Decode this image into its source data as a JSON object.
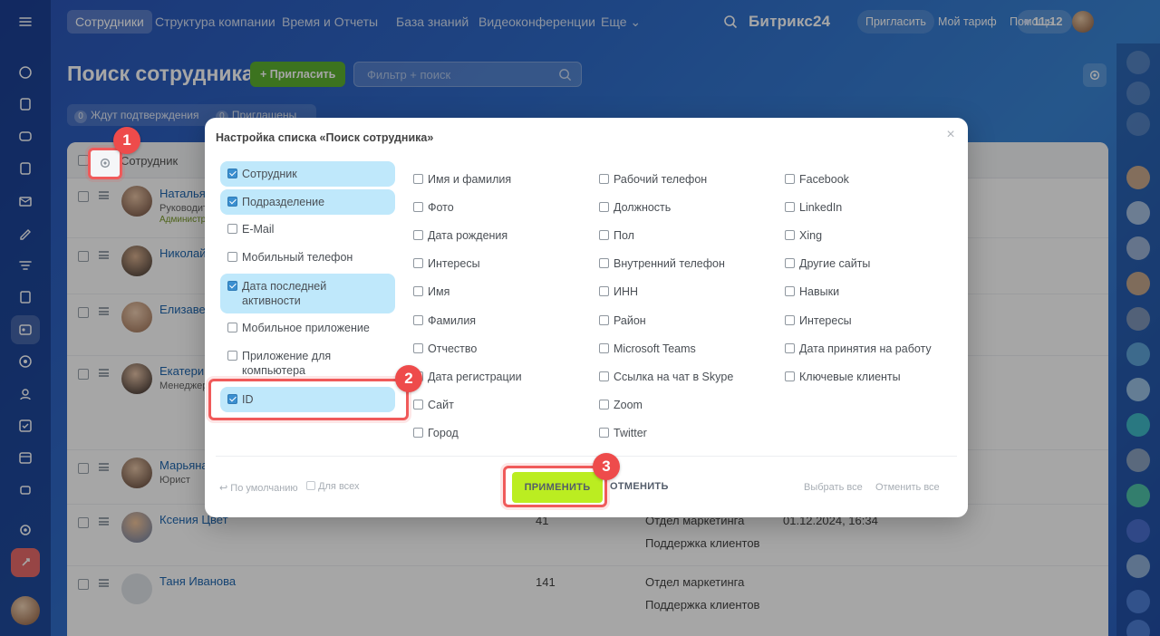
{
  "topbar": {
    "nav": [
      {
        "label": "Сотрудники",
        "active": true
      },
      {
        "label": "Структура компании"
      },
      {
        "label": "Время и Отчеты"
      },
      {
        "label": "База знаний"
      },
      {
        "label": "Видеоконференции"
      },
      {
        "label": "Еще"
      }
    ],
    "brand": "Битрикс24",
    "invite": "Пригласить",
    "tariff": "Мой тариф",
    "help": "Помощь",
    "time": "11:12"
  },
  "page": {
    "title": "Поиск сотрудника",
    "invite_button": "Пригласить",
    "filter_placeholder": "Фильтр + поиск",
    "tabs": [
      {
        "count": "0",
        "label": "Ждут подтверждения"
      },
      {
        "count": "0",
        "label": "Приглашены"
      }
    ]
  },
  "grid": {
    "header_employee": "Сотрудник",
    "rows": [
      {
        "name": "Наталья М",
        "sub": "Руководит",
        "sub2": "Администра"
      },
      {
        "name": "Николай"
      },
      {
        "name": "Елизавета"
      },
      {
        "name": "Екатерин",
        "sub": "Менеджер"
      },
      {
        "name": "Марьяна",
        "sub": "Юрист"
      },
      {
        "name": "Ксения Цвет",
        "id": "41",
        "dept1": "Отдел маркетинга",
        "dept2": "Поддержка клиентов",
        "date": "01.12.2024, 16:34"
      },
      {
        "name": "Таня Иванова",
        "id": "141",
        "dept1": "Отдел маркетинга",
        "dept2": "Поддержка клиентов"
      }
    ]
  },
  "dialog": {
    "title": "Настройка списка «Поиск сотрудника»",
    "columns": [
      [
        {
          "label": "Сотрудник",
          "checked": true
        },
        {
          "label": "Подразделение",
          "checked": true
        },
        {
          "label": "E-Mail",
          "checked": false
        },
        {
          "label": "Мобильный телефон",
          "checked": false
        },
        {
          "label": "Дата последней активности",
          "checked": true
        },
        {
          "label": "Мобильное приложение",
          "checked": false
        },
        {
          "label": "Приложение для компьютера",
          "checked": false
        },
        {
          "label": "ID",
          "checked": true
        }
      ],
      [
        {
          "label": "Имя и фамилия",
          "checked": false
        },
        {
          "label": "Фото",
          "checked": false
        },
        {
          "label": "Дата рождения",
          "checked": false
        },
        {
          "label": "Интересы",
          "checked": false
        },
        {
          "label": "Имя",
          "checked": false
        },
        {
          "label": "Фамилия",
          "checked": false
        },
        {
          "label": "Отчество",
          "checked": false
        },
        {
          "label": "Дата регистрации",
          "checked": false
        },
        {
          "label": "Сайт",
          "checked": false
        },
        {
          "label": "Город",
          "checked": false
        }
      ],
      [
        {
          "label": "Рабочий телефон",
          "checked": false
        },
        {
          "label": "Должность",
          "checked": false
        },
        {
          "label": "Пол",
          "checked": false
        },
        {
          "label": "Внутренний телефон",
          "checked": false
        },
        {
          "label": "ИНН",
          "checked": false
        },
        {
          "label": "Район",
          "checked": false
        },
        {
          "label": "Microsoft Teams",
          "checked": false
        },
        {
          "label": "Ссылка на чат в Skype",
          "checked": false
        },
        {
          "label": "Zoom",
          "checked": false
        },
        {
          "label": "Twitter",
          "checked": false
        }
      ],
      [
        {
          "label": "Facebook",
          "checked": false
        },
        {
          "label": "LinkedIn",
          "checked": false
        },
        {
          "label": "Xing",
          "checked": false
        },
        {
          "label": "Другие сайты",
          "checked": false
        },
        {
          "label": "Навыки",
          "checked": false
        },
        {
          "label": "Интересы",
          "checked": false
        },
        {
          "label": "Дата принятия на работу",
          "checked": false
        },
        {
          "label": "Ключевые клиенты",
          "checked": false
        }
      ]
    ],
    "footer": {
      "default": "По умолчанию",
      "for_all": "Для всех",
      "apply": "ПРИМЕНИТЬ",
      "cancel": "ОТМЕНИТЬ",
      "select_all": "Выбрать все",
      "unselect_all": "Отменить все"
    }
  },
  "markers": [
    "1",
    "2",
    "3"
  ],
  "colors": {
    "accent_green": "#bbed21",
    "highlight": "#f05a5a",
    "checked_bg": "#bfe8fb"
  }
}
